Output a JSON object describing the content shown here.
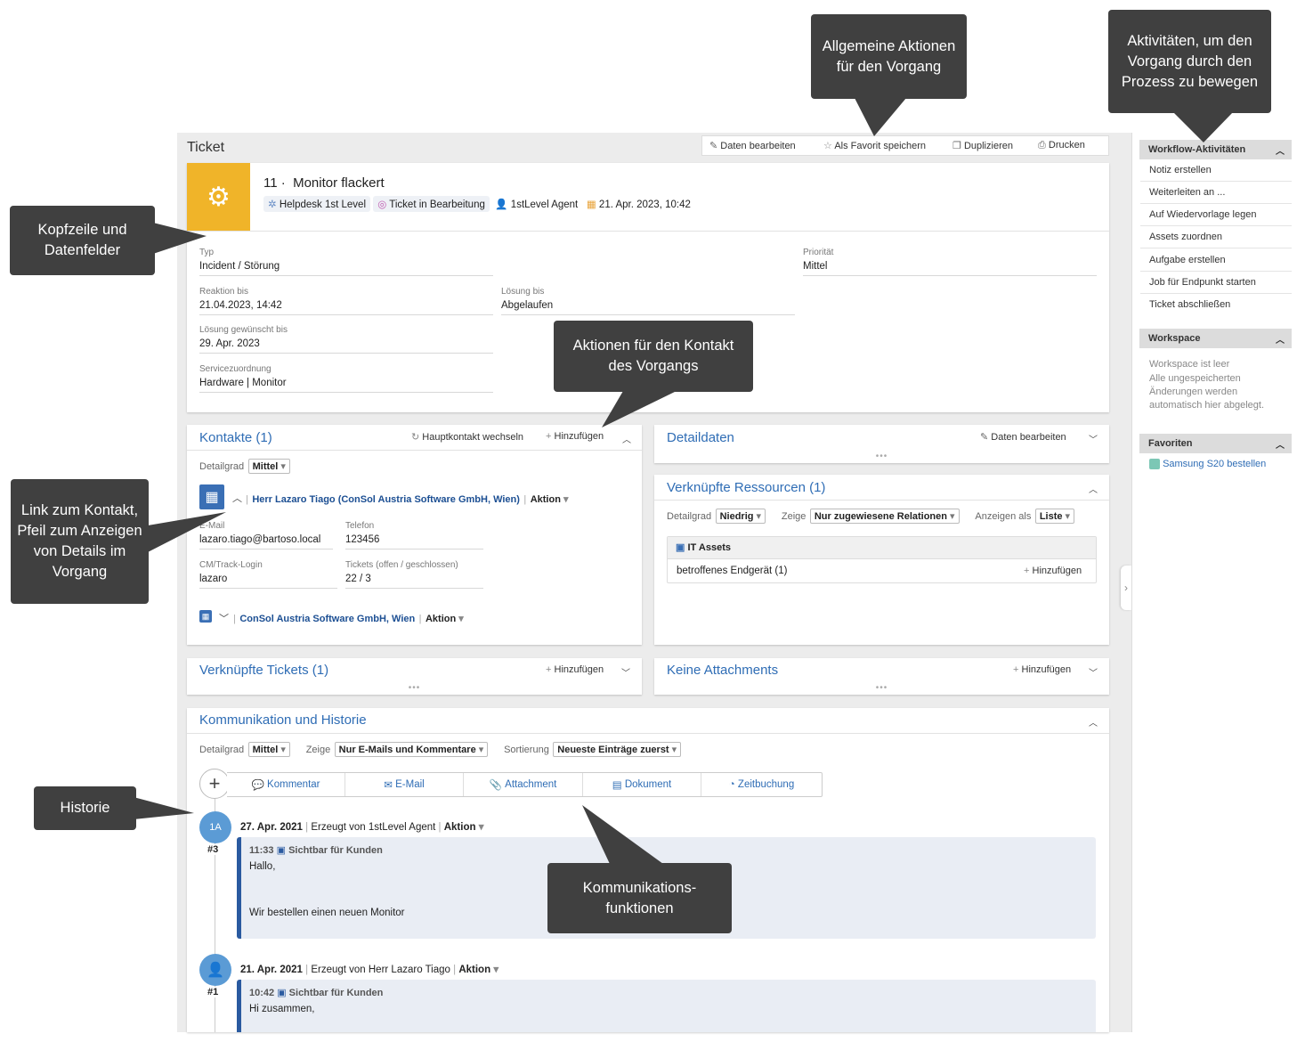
{
  "callouts": {
    "allgemeine": "Allgemeine Aktionen für den Vorgang",
    "aktivitaeten": "Aktivitäten, um den Vorgang durch den Prozess zu bewegen",
    "kopfzeile": "Kopfzeile und Datenfelder",
    "kontakt_aktionen": "Aktionen für den Kontakt des Vorgangs",
    "link_kontakt": "Link zum Kontakt, Pfeil zum Anzeigen von Details im Vorgang",
    "historie": "Historie",
    "kommunikation": "Kommunikations-funktionen"
  },
  "header": {
    "title": "Ticket",
    "actions": [
      "Daten bearbeiten",
      "Als Favorit speichern",
      "Duplizieren",
      "Drucken"
    ]
  },
  "ticket": {
    "number": "11 ·",
    "subject": "Monitor flackert",
    "queue": "Helpdesk 1st Level",
    "status": "Ticket in Bearbeitung",
    "agent": "1stLevel Agent",
    "date": "21. Apr. 2023, 10:42"
  },
  "fields": {
    "typ_label": "Typ",
    "typ_value": "Incident / Störung",
    "prio_label": "Priorität",
    "prio_value": "Mittel",
    "reaktion_label": "Reaktion bis",
    "reaktion_value": "21.04.2023, 14:42",
    "loesung_label": "Lösung bis",
    "loesung_value": "Abgelaufen",
    "gewuenscht_label": "Lösung gewünscht bis",
    "gewuenscht_value": "29. Apr. 2023",
    "service_label": "Servicezuordnung",
    "service_value": "Hardware | Monitor"
  },
  "kontakte": {
    "title": "Kontakte (1)",
    "wechseln": "Hauptkontakt wechseln",
    "hinzufuegen": "Hinzufügen",
    "detailgrad_label": "Detailgrad",
    "detailgrad_value": "Mittel",
    "person": "Herr Lazaro Tiago (ConSol Austria Software GmbH, Wien)",
    "aktion": "Aktion",
    "email_label": "E-Mail",
    "email_value": "lazaro.tiago@bartoso.local",
    "telefon_label": "Telefon",
    "telefon_value": "123456",
    "login_label": "CM/Track-Login",
    "login_value": "lazaro",
    "tickets_label": "Tickets (offen / geschlossen)",
    "tickets_value": "22 / 3",
    "company": "ConSol Austria Software GmbH, Wien"
  },
  "detaildaten": {
    "title": "Detaildaten",
    "edit": "Daten bearbeiten"
  },
  "ressourcen": {
    "title": "Verknüpfte Ressourcen (1)",
    "detailgrad_label": "Detailgrad",
    "detailgrad_value": "Niedrig",
    "zeige_label": "Zeige",
    "zeige_value": "Nur zugewiesene Relationen",
    "anzeigen_label": "Anzeigen als",
    "anzeigen_value": "Liste",
    "group": "IT Assets",
    "item": "betroffenes Endgerät (1)",
    "hinzufuegen": "Hinzufügen"
  },
  "tickets_card": {
    "title": "Verknüpfte Tickets (1)",
    "hinzufuegen": "Hinzufügen"
  },
  "attachments": {
    "title": "Keine Attachments",
    "hinzufuegen": "Hinzufügen"
  },
  "kommunikation": {
    "title": "Kommunikation und Historie",
    "detailgrad_label": "Detailgrad",
    "detailgrad_value": "Mittel",
    "zeige_label": "Zeige",
    "zeige_value": "Nur E-Mails und Kommentare",
    "sort_label": "Sortierung",
    "sort_value": "Neueste Einträge zuerst",
    "toolbar": [
      "Kommentar",
      "E-Mail",
      "Attachment",
      "Dokument",
      "Zeitbuchung"
    ],
    "entries": [
      {
        "avatar": "1A",
        "num": "#3",
        "date": "27. Apr. 2021",
        "creator": "Erzeugt von 1stLevel Agent",
        "aktion": "Aktion",
        "time": "11:33",
        "visibility": "Sichtbar für Kunden",
        "line1": "Hallo,",
        "line2": "Wir bestellen einen neuen Monitor"
      },
      {
        "avatar": "",
        "num": "#1",
        "date": "21. Apr. 2021",
        "creator": "Erzeugt von Herr Lazaro Tiago",
        "aktion": "Aktion",
        "time": "10:42",
        "visibility": "Sichtbar für Kunden",
        "line1": "Hi zusammen,",
        "line2": ""
      }
    ]
  },
  "rpanel": {
    "workflow_title": "Workflow-Aktivitäten",
    "workflow_items": [
      "Notiz erstellen",
      "Weiterleiten an ...",
      "Auf Wiedervorlage legen",
      "Assets zuordnen",
      "Aufgabe erstellen",
      "Job für Endpunkt starten",
      "Ticket abschließen"
    ],
    "workspace_title": "Workspace",
    "workspace_text1": "Workspace ist leer",
    "workspace_text2": "Alle ungespeicherten Änderungen werden automatisch hier abgelegt.",
    "favoriten_title": "Favoriten",
    "favorit_item": "Samsung S20 bestellen"
  },
  "colors": {
    "accent": "#2f6db5",
    "ticket_icon_bg": "#f0b429",
    "callout_bg": "#404040",
    "timeline_bar": "#2a5aa0"
  }
}
